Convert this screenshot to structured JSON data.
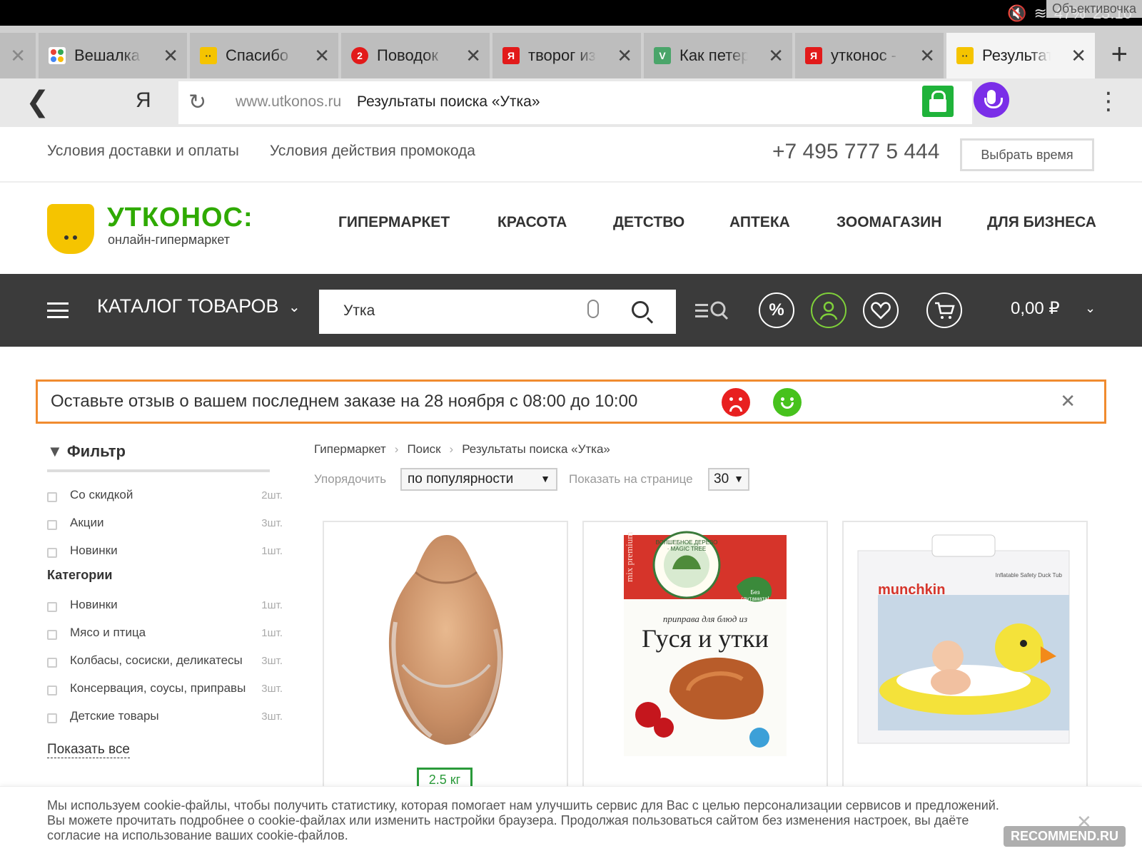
{
  "status_bar": {
    "battery": "47%",
    "clock": "23:10",
    "overlay_text": "Объективочка"
  },
  "browser": {
    "tabs": [
      {
        "label": "Вешалка",
        "fav": "",
        "fav_color": "#ffffff"
      },
      {
        "label": "Спасибо",
        "fav": "··",
        "fav_color": "#f5c400"
      },
      {
        "label": "Поводок",
        "fav": "2",
        "fav_color": "#e21a1a"
      },
      {
        "label": "творог из",
        "fav": "Я",
        "fav_color": "#e21a1a"
      },
      {
        "label": "Как петер",
        "fav": "V",
        "fav_color": "#4aa56a"
      },
      {
        "label": "утконос -",
        "fav": "Я",
        "fav_color": "#e21a1a"
      },
      {
        "label": "Результат",
        "fav": "··",
        "fav_color": "#f5c400"
      }
    ],
    "yandex_glyph": "Я",
    "url_domain": "www.utkonos.ru",
    "url_title": "Результаты поиска «Утка»"
  },
  "top_info": {
    "delivery_link": "Условия доставки и оплаты",
    "promo_link": "Условия действия промокода",
    "phone": "+7 495 777 5 444",
    "time_button": "Выбрать время"
  },
  "logo": {
    "name": "УТКОНОС:",
    "subtitle": "онлайн-гипермаркет"
  },
  "main_nav": [
    "ГИПЕРМАРКЕТ",
    "КРАСОТА",
    "ДЕТСТВО",
    "АПТЕКА",
    "ЗООМАГАЗИН",
    "ДЛЯ БИЗНЕСА"
  ],
  "toolbar": {
    "catalog_label": "КАТАЛОГ ТОВАРОВ",
    "search_value": "Утка",
    "discount_glyph": "%",
    "cart_total": "0,00 ₽"
  },
  "feedback": {
    "text": "Оставьте отзыв о вашем последнем заказе на 28 ноября с 08:00 до 10:00",
    "close": "✕"
  },
  "filter": {
    "title": "Фильтр",
    "options": [
      {
        "label": "Со скидкой",
        "count": "2шт."
      },
      {
        "label": "Акции",
        "count": "3шт."
      },
      {
        "label": "Новинки",
        "count": "1шт."
      }
    ],
    "categories_title": "Категории",
    "categories": [
      {
        "label": "Новинки",
        "count": "1шт."
      },
      {
        "label": "Мясо и птица",
        "count": "1шт."
      },
      {
        "label": "Колбасы, сосиски, деликатесы",
        "count": "3шт."
      },
      {
        "label": "Консервация, соусы, приправы",
        "count": "3шт."
      },
      {
        "label": "Детские товары",
        "count": "3шт."
      }
    ],
    "show_all": "Показать все"
  },
  "results": {
    "breadcrumb": [
      "Гипермаркет",
      "Поиск",
      "Результаты поиска «Утка»"
    ],
    "sort_label": "Упорядочить",
    "sort_value": "по популярности",
    "per_page_label": "Показать на странице",
    "per_page_value": "30",
    "products": [
      {
        "image": "raw duck in plastic wrap",
        "weight_badge": "2.5 кг"
      },
      {
        "image": "spice packet: Гуся и утки",
        "brand_text": "mix premium",
        "seal_text": "ВОЛШЕБНОЕ ДЕРЕВО · MAGIC TREE",
        "leaf_text": "Без глутамата!",
        "subtitle": "приправа для блюд из",
        "title": "Гуся и утки"
      },
      {
        "image": "munchkin inflatable duck tub box",
        "brand": "munchkin",
        "box_text": "Inflatable Safety Duck Tub"
      }
    ]
  },
  "cookie": {
    "text": "Мы используем cookie-файлы, чтобы получить статистику, которая помогает нам улучшить сервис для Вас с целью персонализации сервисов и предложений. Вы можете прочитать подробнее о cookie-файлах или изменить настройки браузера. Продолжая пользоваться сайтом без изменения настроек, вы даёте согласие на использование ваших cookie-файлов."
  },
  "watermark": "RECOMMEND.RU"
}
